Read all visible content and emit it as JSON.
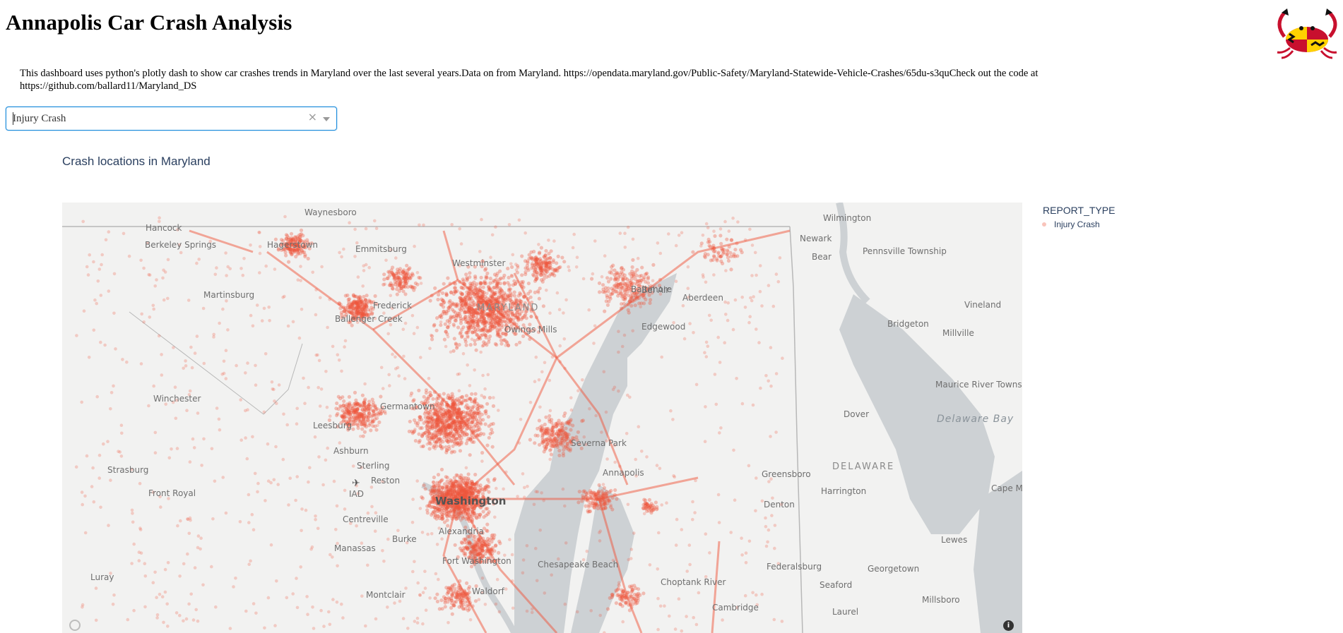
{
  "page": {
    "title": "Annapolis Car Crash Analysis",
    "description": "This dashboard uses python's plotly dash to show car crashes trends in Maryland over the last several years.Data on from Maryland. https://opendata.maryland.gov/Public-Safety/Maryland-Statewide-Vehicle-Crashes/65du-s3quCheck out the code at https://github.com/ballard11/Maryland_DS"
  },
  "logo": {
    "icon": "maryland-flag-crab-logo"
  },
  "dropdown": {
    "value": "Injury Crash",
    "clear_icon": "×",
    "arrow_icon": "chevron-down-icon"
  },
  "chart": {
    "title": "Crash locations in Maryland",
    "legend": {
      "title": "REPORT_TYPE",
      "items": [
        "Injury Crash"
      ]
    },
    "marker_color": "#ef553b",
    "map_labels": [
      "Waynesboro",
      "Hancock",
      "Berkeley Springs",
      "Hagerstown",
      "Emmitsburg",
      "Westminster",
      "Martinsburg",
      "Frederick",
      "Ballenger Creek",
      "MARYLAND",
      "Owings Mills",
      "Baltimore",
      "Bel Air",
      "Aberdeen",
      "Edgewood",
      "Wilmington",
      "Newark",
      "Bear",
      "Pennsville Township",
      "Vineland",
      "Bridgeton",
      "Millville",
      "Maurice River Township",
      "Winchester",
      "Leesburg",
      "Germantown",
      "Ashburn",
      "Sterling",
      "Reston",
      "IAD",
      "Washington",
      "Alexandria",
      "Centreville",
      "Burke",
      "Manassas",
      "Fort Washington",
      "Strasburg",
      "Front Royal",
      "Luray",
      "Montclair",
      "Severna Park",
      "Annapolis",
      "Dover",
      "DELAWARE",
      "Delaware Bay",
      "Greensboro",
      "Harrington",
      "Denton",
      "Cape May",
      "Chesapeake Beach",
      "Choptank River",
      "Federalsburg",
      "Georgetown",
      "Seaford",
      "Lewes",
      "Laurel",
      "Millsboro",
      "Cambridge",
      "Waldorf"
    ],
    "map_icons": {
      "attribution": "mapbox-logo-icon",
      "info": "info-icon"
    }
  }
}
